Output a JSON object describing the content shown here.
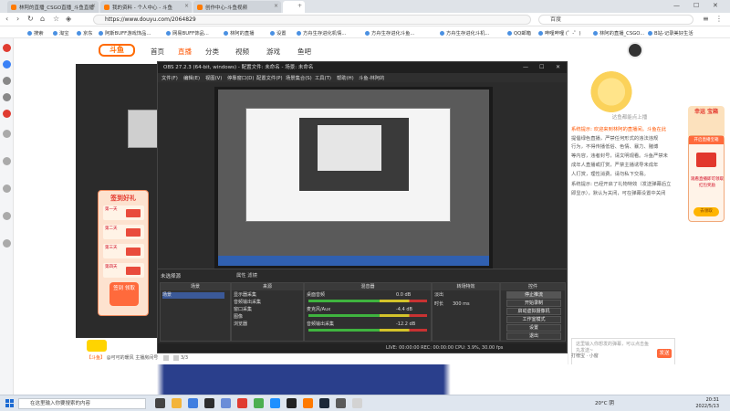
{
  "browser": {
    "tabs": [
      {
        "label": "林阿的直播_CSGO直播_斗鱼直播",
        "active": false
      },
      {
        "label": "我的资料 - 个人中心 - 斗鱼",
        "active": false
      },
      {
        "label": "创作中心-斗鱼视频",
        "active": false
      },
      {
        "label": "",
        "active": true
      }
    ],
    "url": "https://www.douyu.com/2064829",
    "search_text": "百度",
    "bookmarks": [
      "搜索",
      "淘宝",
      "京东",
      "阿斯BUFF游戏饰品...",
      "网易BUFF饰品...",
      "林阿的直播",
      "设置",
      "方舟生存进化机情...",
      "方舟生存进化斗鱼...",
      "方舟生存进化斗机...",
      "QQ邮箱",
      "哔哩哔哩 (゜-゜)",
      "林阿的直播_CSGO...",
      "B站-记录美好生活"
    ]
  },
  "douyu": {
    "logo_text": "斗鱼",
    "nav": [
      "首页",
      "直播",
      "分类",
      "视频",
      "游戏",
      "鱼吧"
    ],
    "nav_active": 1,
    "sign_card": {
      "title": "签到好礼",
      "days": [
        "第一天",
        "第二天",
        "第三天",
        "第四天"
      ],
      "button": "签到\n领取"
    },
    "announce_title": "达鱼都能点上播",
    "announce_lines": [
      "系统提示: 欢迎来到林阿的直播间。斗鱼在此",
      "提倡绿色直播，严禁任何形式的违法违规",
      "行为，不得传播低俗、色情、暴力、赌博",
      "等内容，违者封号，请文明观看。斗鱼严禁未",
      "成年人直播或打赏，严禁主播诱导未成年",
      "人打赏，理性消费，请勿私下交易。"
    ],
    "promo_text": "系统提示: 已经开启了礼物特效（发送弹幕后立即显示），默认为关闭，可在弹幕设置中关闭",
    "chat_placeholder": "这里输入你想发的弹幕，可以点击鱼丸发送~",
    "send_label": "发送",
    "chat_options": "打榜宝 · 小窗",
    "lucky_box": "幸运\n宝箱",
    "side_box": {
      "header": "开启直播宝箱",
      "text": "观看直播即可领取\n红包奖励",
      "button": "去领取"
    },
    "ticker_prefix": "【斗鱼】",
    "ticker_text": "@可可的暖风 主播房间号",
    "ticker_count": "3/3"
  },
  "obs": {
    "title": "OBS 27.2.3 (64-bit, windows) - 配置文件: 未命名 - 场景: 未命名",
    "menu": [
      "文件(F)",
      "编辑(E)",
      "视图(V)",
      "停靠窗口(D)",
      "配置文件(P)",
      "场景集合(S)",
      "工具(T)",
      "帮助(H)",
      "斗鱼-林阿的"
    ],
    "current_scene": "未选择源",
    "src_tabs": "属性   滤镜",
    "scenes": {
      "header": "场景",
      "items": [
        "场景"
      ]
    },
    "sources": {
      "header": "来源",
      "items": [
        "显示器采集",
        "音频输出采集",
        "窗口采集",
        "图像",
        "浏览器"
      ]
    },
    "mixer": {
      "header": "混音器",
      "channels": [
        {
          "name": "桌面音频",
          "db": "0.0 dB"
        },
        {
          "name": "麦克风/Aux",
          "db": "-4.4 dB"
        },
        {
          "name": "音频输出采集",
          "db": "-12.2 dB"
        }
      ]
    },
    "transitions": {
      "header": "转场特效",
      "type": "淡出",
      "duration_label": "时长",
      "duration": "300 ms"
    },
    "controls": {
      "header": "控件",
      "buttons": [
        "停止推流",
        "开始录制",
        "启动虚拟摄像机",
        "工作室模式",
        "设置",
        "退出"
      ]
    },
    "status": "LIVE: 00:00:00   REC: 00:00:00   CPU: 3.9%, 30.00 fps"
  },
  "taskbar": {
    "search_placeholder": "在这里输入你要搜索的内容",
    "weather": "20°C 阴",
    "time": "20:31",
    "date": "2022/5/13"
  },
  "colors": {
    "accent": "#ff5500",
    "obs_bg": "#2b2b2b",
    "taskbar": "#dfe6ef"
  }
}
